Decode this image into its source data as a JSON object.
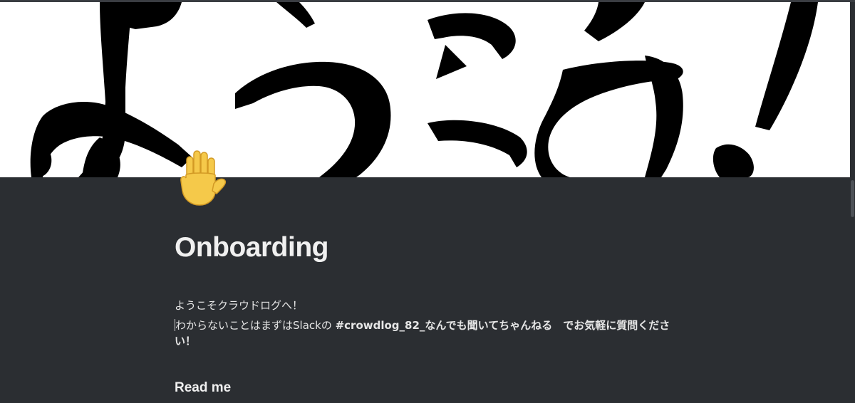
{
  "cover": {
    "lettering": "ようこそ!"
  },
  "page": {
    "icon": "raised-hand-emoji",
    "title": "Onboarding",
    "welcome": "ようこそクラウドログへ！",
    "instruction_prefix": "わからないことはまずはSlackの ",
    "channel": "#crowdlog_82_なんでも聞いてちゃんねる",
    "instruction_suffix": "　でお気軽に質問ください！",
    "section_heading": "Read me"
  },
  "colors": {
    "background": "#2b2e32",
    "text": "#e9e9e9",
    "cover": "#ffffff",
    "ink": "#000000"
  }
}
